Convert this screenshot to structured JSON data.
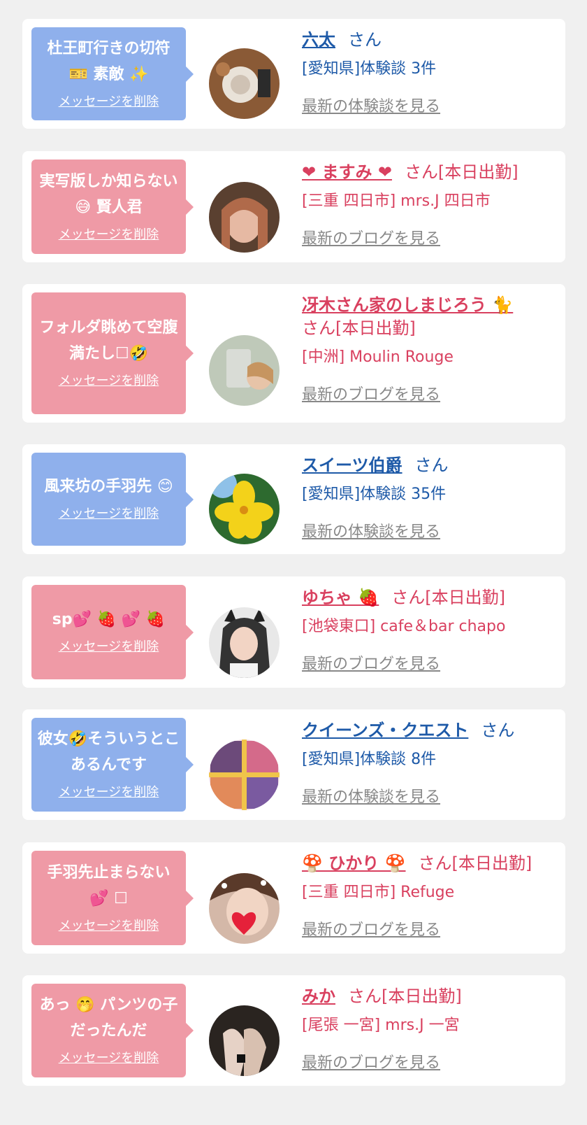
{
  "colors": {
    "blue_bubble": "#8fb0ec",
    "pink_bubble": "#ef9aa6",
    "blue_text": "#1e5aa8",
    "pink_text": "#d9405f",
    "link_gray": "#888888"
  },
  "cards": [
    {
      "type": "blue",
      "message": "杜王町行きの切符 🎫 素敵 ✨",
      "delete_label": "メッセージを削除",
      "name": "六太",
      "suffix": "さん",
      "location": "[愛知県]体験談 3件",
      "more_label": "最新の体験談を見る"
    },
    {
      "type": "pink",
      "message": "実写版しか知らない 😅 賢人君",
      "delete_label": "メッセージを削除",
      "name": "❤ ますみ ❤",
      "suffix": "さん[本日出勤]",
      "location": "[三重 四日市] mrs.J 四日市",
      "more_label": "最新のブログを見る"
    },
    {
      "type": "pink",
      "message": "フォルダ眺めて空腹満たし☐🤣",
      "delete_label": "メッセージを削除",
      "name": "冴木さん家のしまじろう 🐈",
      "suffix": "さん[本日出勤]",
      "location": "[中洲] Moulin Rouge",
      "more_label": "最新のブログを見る"
    },
    {
      "type": "blue",
      "message": "風来坊の手羽先 😊",
      "delete_label": "メッセージを削除",
      "name": "スイーツ伯爵",
      "suffix": "さん",
      "location": "[愛知県]体験談 35件",
      "more_label": "最新の体験談を見る"
    },
    {
      "type": "pink",
      "message": "sp💕 🍓 💕 🍓",
      "delete_label": "メッセージを削除",
      "name": "ゆちゃ 🍓",
      "suffix": "さん[本日出勤]",
      "location": "[池袋東口] cafe＆bar chapo",
      "more_label": "最新のブログを見る"
    },
    {
      "type": "blue",
      "message": "彼女🤣そういうとこあるんです",
      "delete_label": "メッセージを削除",
      "name": "クイーンズ・クエスト",
      "suffix": "さん",
      "location": "[愛知県]体験談 8件",
      "more_label": "最新の体験談を見る"
    },
    {
      "type": "pink",
      "message": "手羽先止まらない 💕 ☐",
      "delete_label": "メッセージを削除",
      "name": "🍄 ひかり 🍄",
      "suffix": "さん[本日出勤]",
      "location": "[三重 四日市] Refuge",
      "more_label": "最新のブログを見る"
    },
    {
      "type": "pink",
      "message": "あっ 🤭 パンツの子だったんだ",
      "delete_label": "メッセージを削除",
      "name": "みか",
      "suffix": "さん[本日出勤]",
      "location": "[尾張 一宮] mrs.J 一宮",
      "more_label": "最新のブログを見る"
    }
  ]
}
